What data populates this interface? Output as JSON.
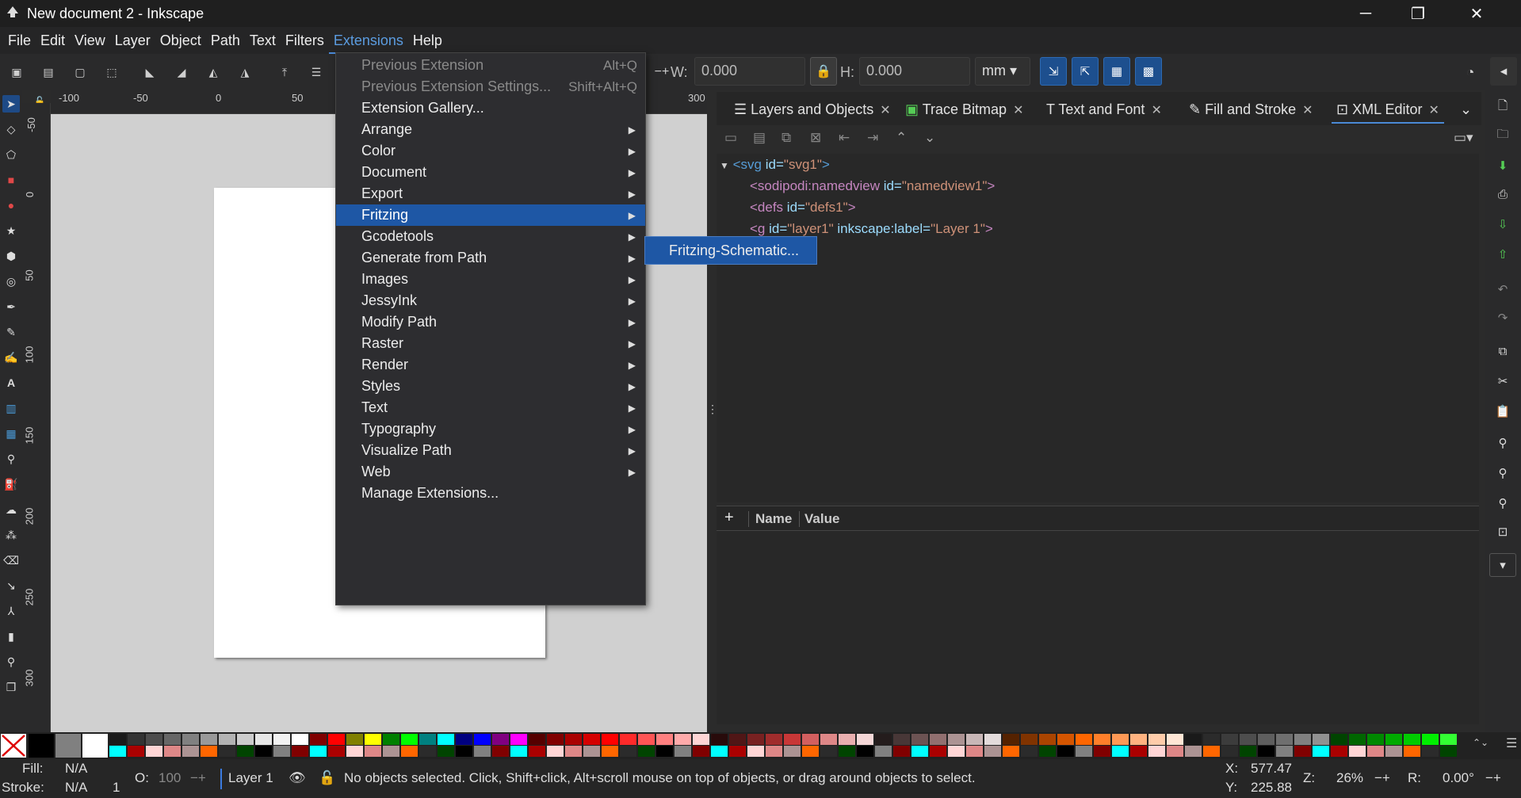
{
  "window": {
    "title": "New document 2 - Inkscape",
    "controls": [
      "─",
      "❐",
      "✕"
    ]
  },
  "menubar": [
    "File",
    "Edit",
    "View",
    "Layer",
    "Object",
    "Path",
    "Text",
    "Filters",
    "Extensions",
    "Help"
  ],
  "toolbar": {
    "w_label": "W:",
    "w_value": "0.000",
    "h_label": "H:",
    "h_value": "0.000",
    "unit": "mm",
    "lock": "🔒"
  },
  "ruler": {
    "h": [
      "-100",
      "-50",
      "0",
      "50",
      "300"
    ],
    "v": [
      "-50",
      "0",
      "50",
      "100",
      "150",
      "200",
      "250",
      "300"
    ]
  },
  "extensions_menu": [
    {
      "label": "Previous Extension",
      "shortcut": "Alt+Q",
      "disabled": true
    },
    {
      "label": "Previous Extension Settings...",
      "shortcut": "Shift+Alt+Q",
      "disabled": true
    },
    {
      "label": "Extension Gallery..."
    },
    {
      "label": "Arrange",
      "sub": true
    },
    {
      "label": "Color",
      "sub": true
    },
    {
      "label": "Document",
      "sub": true
    },
    {
      "label": "Export",
      "sub": true
    },
    {
      "label": "Fritzing",
      "sub": true,
      "highlight": true
    },
    {
      "label": "Gcodetools",
      "sub": true
    },
    {
      "label": "Generate from Path",
      "sub": true
    },
    {
      "label": "Images",
      "sub": true
    },
    {
      "label": "JessyInk",
      "sub": true
    },
    {
      "label": "Modify Path",
      "sub": true
    },
    {
      "label": "Raster",
      "sub": true
    },
    {
      "label": "Render",
      "sub": true
    },
    {
      "label": "Styles",
      "sub": true
    },
    {
      "label": "Text",
      "sub": true
    },
    {
      "label": "Typography",
      "sub": true
    },
    {
      "label": "Visualize Path",
      "sub": true
    },
    {
      "label": "Web",
      "sub": true
    },
    {
      "label": "Manage Extensions..."
    }
  ],
  "submenu": {
    "label": "Fritzing-Schematic..."
  },
  "tabs": [
    "Layers and Objects",
    "Trace Bitmap",
    "Text and Font",
    "Fill and Stroke",
    "XML Editor"
  ],
  "xml": {
    "n1": {
      "tag": "<svg",
      "attr": "id=",
      "val": "\"svg1\"",
      "end": ">"
    },
    "n2": {
      "tag": "<sodipodi:namedview",
      "attr": "id=",
      "val": "\"namedview1\"",
      "end": ">"
    },
    "n3": {
      "tag": "<defs",
      "attr": "id=",
      "val": "\"defs1\"",
      "end": ">"
    },
    "n4": {
      "tag": "<g",
      "attr": "id=",
      "val": "\"layer1\"",
      "attr2": "inkscape:label=",
      "val2": "\"Layer 1\"",
      "end": ">"
    }
  },
  "attr_header": {
    "plus": "+",
    "name": "Name",
    "value": "Value"
  },
  "status": {
    "fill_label": "Fill:",
    "fill_val": "N/A",
    "stroke_label": "Stroke:",
    "stroke_val": "N/A",
    "stroke_w": "1",
    "opacity_label": "O:",
    "opacity_val": "100",
    "layer": "Layer 1",
    "message": "No objects selected. Click, Shift+click, Alt+scroll mouse on top of objects, or drag around objects to select.",
    "x_label": "X:",
    "x_val": "577.47",
    "y_label": "Y:",
    "y_val": "225.88",
    "zoom_label": "Z:",
    "zoom_val": "26%",
    "rot_label": "R:",
    "rot_val": "0.00°"
  },
  "palette_colors": [
    "#000000",
    "#808080",
    "#ffffff",
    "#1a1a1a",
    "#333333",
    "#4d4d4d",
    "#666666",
    "#808080",
    "#999999",
    "#b3b3b3",
    "#cccccc",
    "#e6e6e6",
    "#f2f2f2",
    "#ffffff",
    "#800000",
    "#ff0000",
    "#808000",
    "#ffff00",
    "#008000",
    "#00ff00",
    "#008080",
    "#00ffff",
    "#000080",
    "#0000ff",
    "#800080",
    "#ff00ff",
    "#550000",
    "#800000",
    "#aa0000",
    "#d40000",
    "#ff0000",
    "#ff2a2a",
    "#ff5555",
    "#ff8080",
    "#ffaaaa",
    "#ffd5d5",
    "#280b0b",
    "#501616",
    "#782121",
    "#a02c2c",
    "#c83737",
    "#d35f5f",
    "#de8787",
    "#e9afaf",
    "#f4d7d7",
    "#241c1c",
    "#483737",
    "#6c5353",
    "#916f6f",
    "#ac9393",
    "#c8b7b7",
    "#e3dbdb",
    "#552200",
    "#803300",
    "#aa4400",
    "#d45500",
    "#ff6600",
    "#ff7f2a",
    "#ff9955",
    "#ffb380",
    "#ffccaa",
    "#ffe6d5",
    "#1a1a1a",
    "#2b2b2b",
    "#3c3c3c",
    "#4d4d4d",
    "#5e5e5e",
    "#6f6f6f",
    "#808080",
    "#919191",
    "#004400",
    "#006600",
    "#008800",
    "#00aa00",
    "#00cc00",
    "#00ee00",
    "#33ff33"
  ]
}
